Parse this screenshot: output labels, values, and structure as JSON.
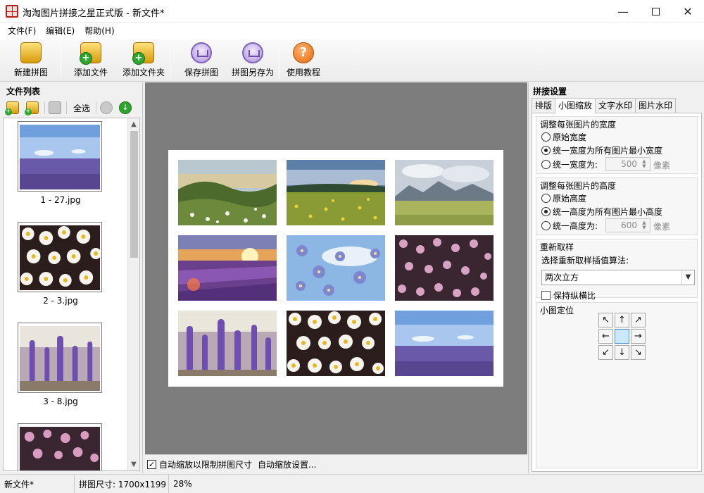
{
  "window": {
    "title": "淘淘图片拼接之星正式版 - 新文件*",
    "controls": {
      "minimize": "—",
      "close": "✕"
    }
  },
  "menu": [
    {
      "label": "文件(F)"
    },
    {
      "label": "编辑(E)"
    },
    {
      "label": "帮助(H)"
    }
  ],
  "toolbar": {
    "new_collage": "新建拼图",
    "add_file": "添加文件",
    "add_folder": "添加文件夹",
    "save_collage": "保存拼图",
    "save_collage_as": "拼图另存为",
    "tutorial": "使用教程",
    "help_glyph": "?"
  },
  "file_panel": {
    "title": "文件列表",
    "select_all": "全选",
    "down_glyph": "↓",
    "scroll_up": "▲",
    "scroll_down": "▼",
    "files": [
      {
        "name": "1 - 27.jpg",
        "thumb": "lavender-field"
      },
      {
        "name": "2 - 3.jpg",
        "thumb": "daisies"
      },
      {
        "name": "3 - 8.jpg",
        "thumb": "lupines"
      },
      {
        "name": "",
        "thumb": "pink-flowers"
      }
    ]
  },
  "canvas": {
    "tiles": [
      "meadow-hills",
      "sunset-field",
      "mountain-meadow",
      "lavender-sunset",
      "blue-flowers",
      "pink-flowers",
      "lupines",
      "daisies",
      "lavender-field"
    ],
    "auto_scale_checked": true,
    "auto_scale_label": "自动缩放以限制拼图尺寸",
    "auto_scale_settings": "自动缩放设置...",
    "check_glyph": "✓"
  },
  "settings_panel": {
    "title": "拼接设置",
    "tabs": [
      {
        "label": "排版",
        "active": false
      },
      {
        "label": "小图缩放",
        "active": true
      },
      {
        "label": "文字水印",
        "active": false
      },
      {
        "label": "图片水印",
        "active": false
      }
    ],
    "width_group": {
      "title": "调整每张图片的宽度",
      "options": [
        "原始宽度",
        "统一宽度为所有图片最小宽度",
        "统一宽度为:"
      ],
      "selected": 1,
      "value": "500",
      "unit": "像素"
    },
    "height_group": {
      "title": "调整每张图片的高度",
      "options": [
        "原始高度",
        "统一高度为所有图片最小高度",
        "统一高度为:"
      ],
      "selected": 1,
      "value": "600",
      "unit": "像素"
    },
    "resample_group": {
      "title": "重新取样",
      "algo_label": "选择重新取样插值算法:",
      "algo_value": "两次立方",
      "keep_ratio_label": "保持纵横比",
      "keep_ratio_checked": false
    },
    "position_group": {
      "title": "小图定位",
      "arrows": [
        "↖",
        "↑",
        "↗",
        "←",
        "",
        "→",
        "↙",
        "↓",
        "↘"
      ],
      "selected": 4
    }
  },
  "statusbar": {
    "file": "新文件*",
    "size": "拼图尺寸: 1700x1199",
    "zoom": "28%"
  }
}
